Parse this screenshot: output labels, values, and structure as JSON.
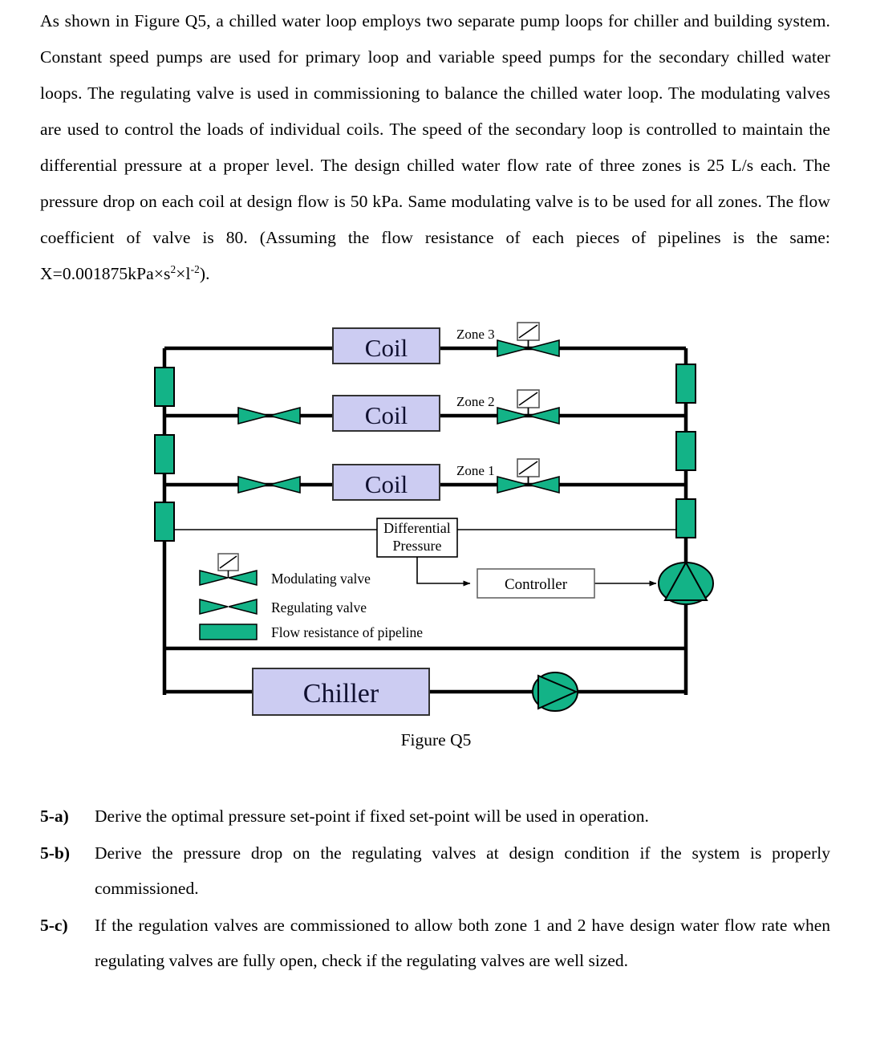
{
  "document": {
    "intro_paragraph": "As shown in Figure Q5, a chilled water loop employs two separate pump loops for chiller and building system. Constant speed pumps are used for primary loop and variable speed pumps for the secondary chilled water loops. The regulating valve is used in commissioning to balance the chilled water loop. The modulating valves are used to control the loads of individual coils. The speed of the secondary loop is controlled to maintain the differential pressure at a proper level.  The design chilled water flow rate of three zones is 25 L/s each. The pressure drop on each coil at design flow is 50 kPa. Same modulating valve is to be used for all zones. The flow coefficient of valve is 80. (Assuming the flow resistance of each pieces of pipelines is the same:",
    "formula_prefix": "X=0.001875kPa×s",
    "formula_sup1": "2",
    "formula_mid": "×l",
    "formula_sup2": "-2",
    "formula_suffix": ").",
    "figure_caption": "Figure Q5"
  },
  "figure": {
    "coil_label": "Coil",
    "chiller_label": "Chiller",
    "zone_labels": [
      "Zone 1",
      "Zone 2",
      "Zone 3"
    ],
    "differential_pressure_line1": "Differential",
    "differential_pressure_line2": "Pressure",
    "controller_label": "Controller",
    "legend": [
      {
        "symbol": "modulating-valve",
        "label": "Modulating valve"
      },
      {
        "symbol": "regulating-valve",
        "label": "Regulating valve"
      },
      {
        "symbol": "flow-resistance",
        "label": "Flow resistance of pipeline"
      }
    ],
    "colors": {
      "coil_fill": "#ccccf2",
      "coil_stroke": "#333333",
      "valve_fill": "#13b387",
      "valve_stroke": "#000000",
      "resistance_fill": "#13b387",
      "pump_fill": "#13b387",
      "pipe_stroke": "#000000",
      "sensing_stroke": "#000000"
    }
  },
  "questions": [
    {
      "label": "5-a)",
      "text": "Derive the optimal pressure set-point if fixed set-point will be used in operation.",
      "justify": false
    },
    {
      "label": "5-b)",
      "text": "Derive the pressure drop on the regulating valves at design condition if the system is properly commissioned.",
      "justify": true
    },
    {
      "label": "5-c)",
      "text": "If the regulation valves are commissioned to allow both zone 1 and 2 have design water flow rate when regulating valves are fully open, check if the regulating valves are well sized.",
      "justify": true
    }
  ]
}
